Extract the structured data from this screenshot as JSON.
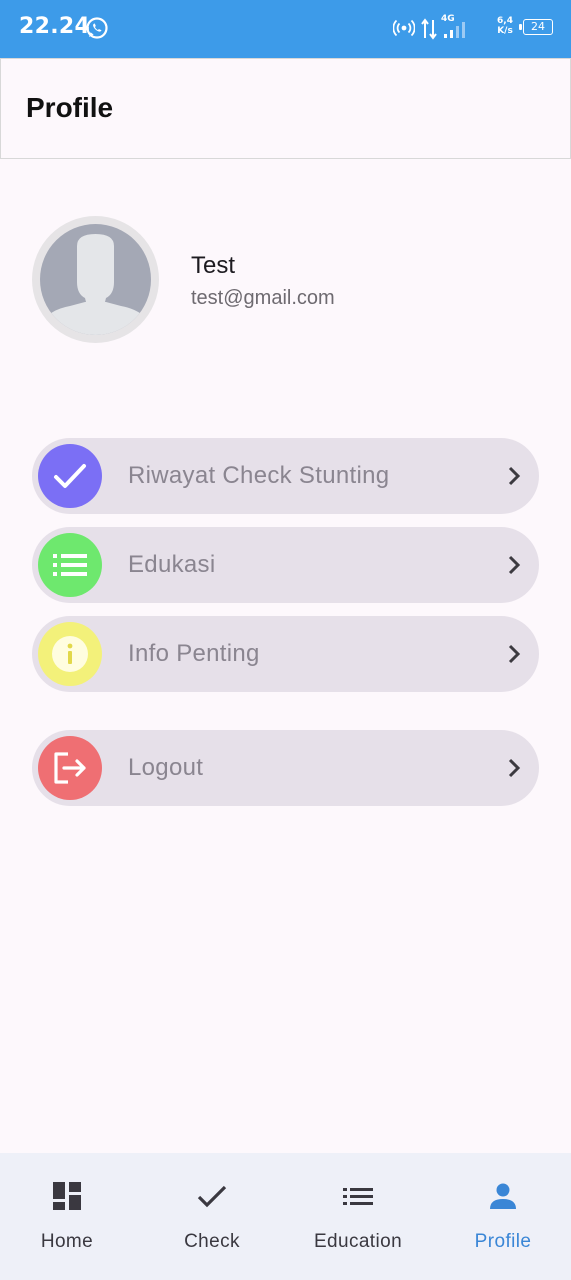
{
  "status_bar": {
    "time": "22.24",
    "network_type": "4G",
    "net_speed_value": "6,4",
    "net_speed_unit": "K/s",
    "battery": "24"
  },
  "app_bar": {
    "title": "Profile"
  },
  "profile": {
    "name": "Test",
    "email": "test@gmail.com"
  },
  "menu": [
    {
      "label": "Riwayat Check Stunting",
      "icon": "check-icon",
      "color": "#7b6ff5"
    },
    {
      "label": "Edukasi",
      "icon": "list-icon",
      "color": "#6ee86e"
    },
    {
      "label": "Info Penting",
      "icon": "info-icon",
      "color": "#f3f17a"
    },
    {
      "label": "Logout",
      "icon": "logout-icon",
      "color": "#ef6f73"
    }
  ],
  "bottom_nav": [
    {
      "label": "Home",
      "icon": "dashboard-icon",
      "active": false
    },
    {
      "label": "Check",
      "icon": "check-icon",
      "active": false
    },
    {
      "label": "Education",
      "icon": "list-icon",
      "active": false
    },
    {
      "label": "Profile",
      "icon": "person-icon",
      "active": true
    }
  ],
  "colors": {
    "status_bar": "#3d9be9",
    "menu_bg": "#e6e0e9",
    "nav_active": "#3a86d6",
    "background": "#fdf8fc"
  }
}
